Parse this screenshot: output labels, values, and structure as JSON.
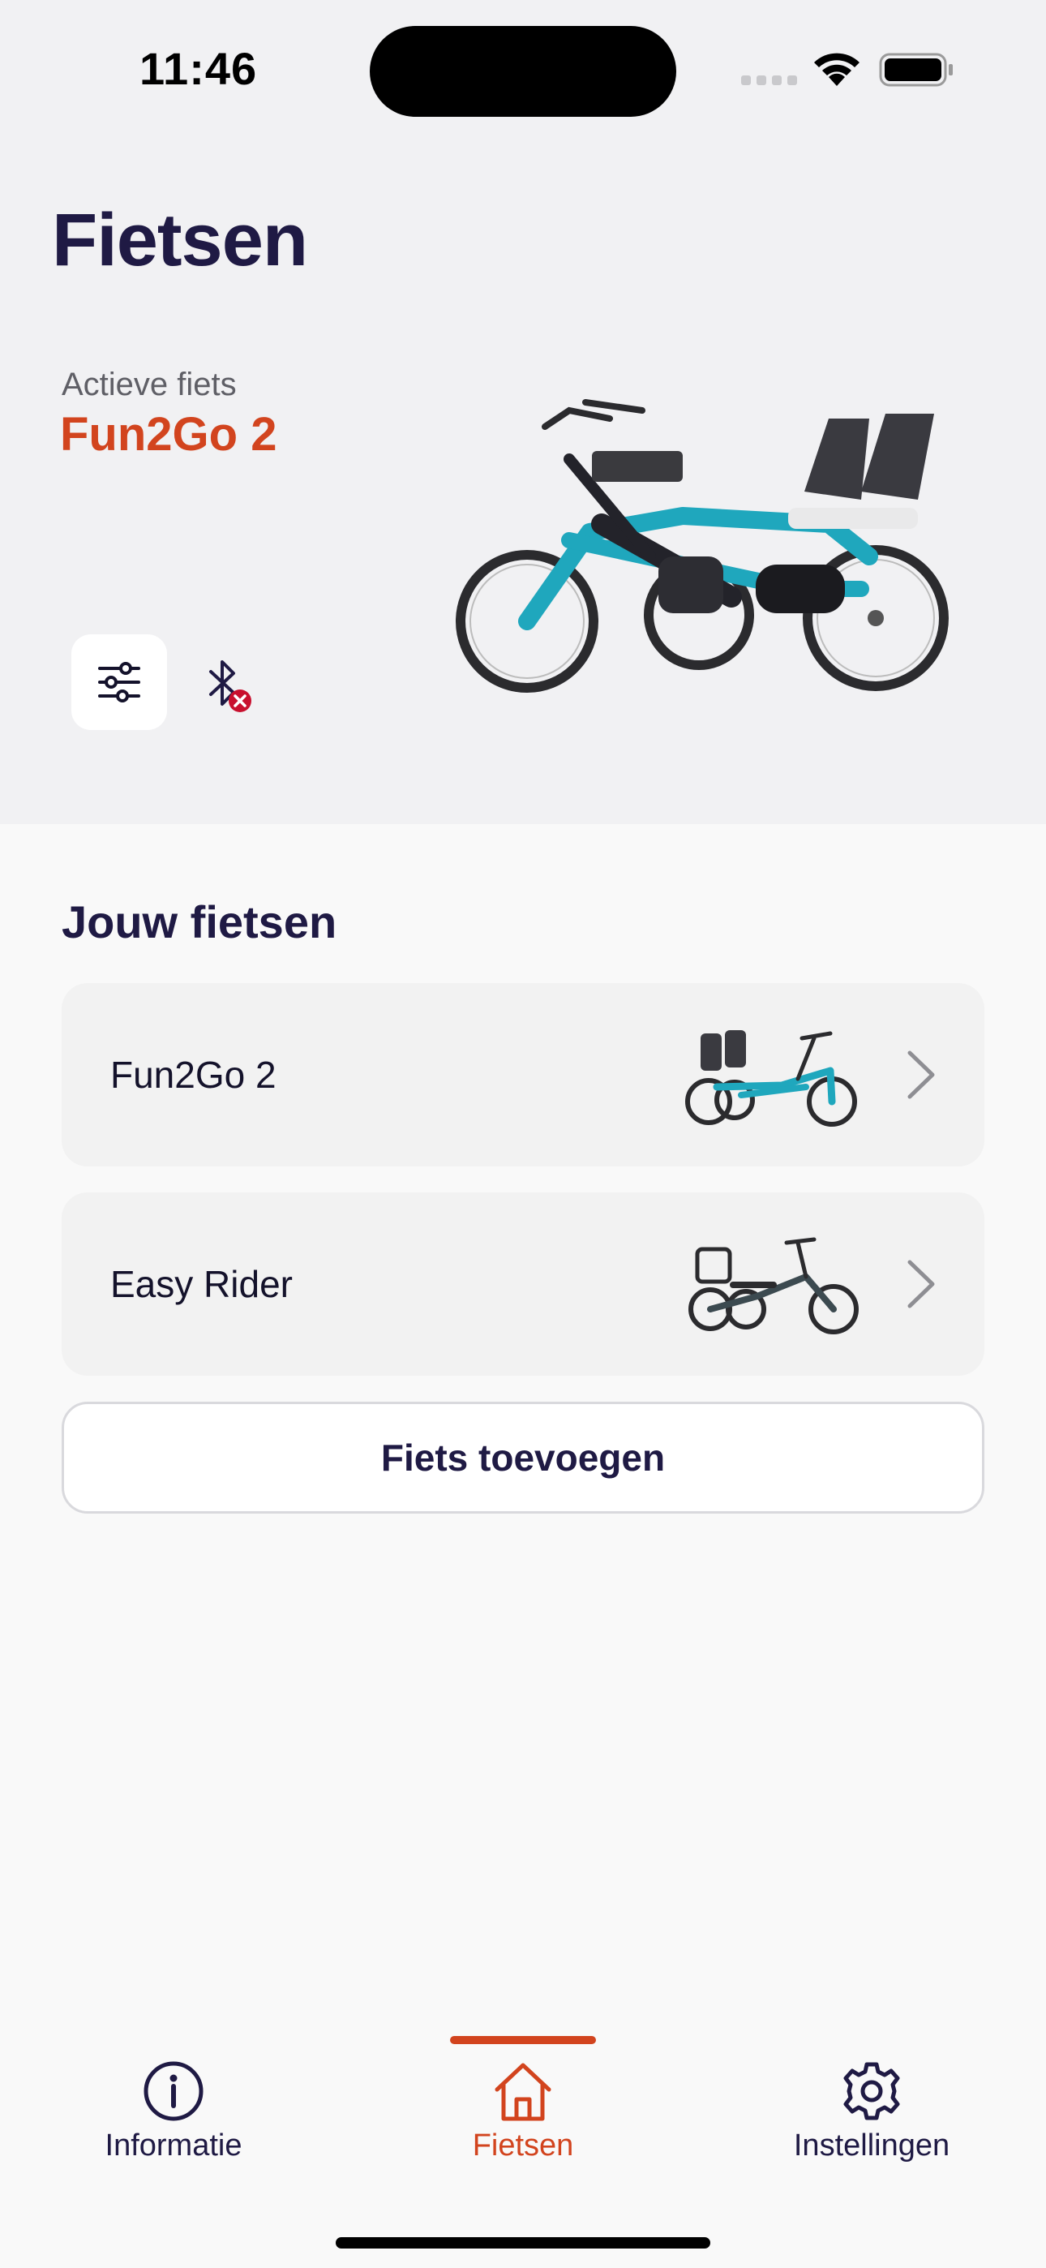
{
  "status_bar": {
    "time": "11:46"
  },
  "header": {
    "title": "Fietsen"
  },
  "active_bike": {
    "label": "Actieve fiets",
    "name": "Fun2Go 2",
    "settings_icon": "sliders-icon",
    "bluetooth_icon": "bluetooth-disconnected-icon"
  },
  "bikes_section": {
    "title": "Jouw fietsen",
    "items": [
      {
        "name": "Fun2Go 2",
        "icon": "chevron-right-icon"
      },
      {
        "name": "Easy Rider",
        "icon": "chevron-right-icon"
      }
    ],
    "add_button_label": "Fiets toevoegen"
  },
  "tab_bar": {
    "tabs": [
      {
        "label": "Informatie",
        "icon": "info-icon",
        "active": false
      },
      {
        "label": "Fietsen",
        "icon": "home-icon",
        "active": true
      },
      {
        "label": "Instellingen",
        "icon": "gear-icon",
        "active": false
      }
    ]
  },
  "colors": {
    "accent": "#d2441e",
    "navy": "#1f1a44",
    "teal": "#1fa7bd",
    "hero_bg": "#f1f1f3",
    "card_bg": "#f2f2f2",
    "error_red": "#c8102e"
  }
}
